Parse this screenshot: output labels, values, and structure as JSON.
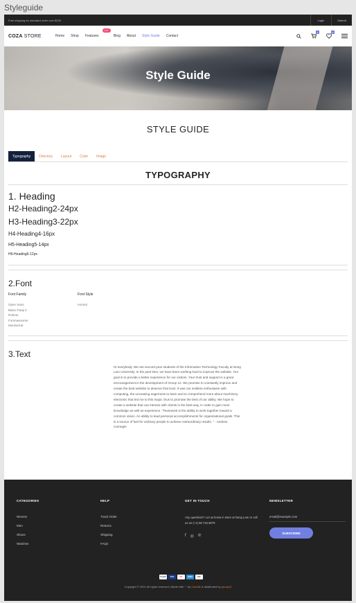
{
  "window_title": "Styleguide",
  "topbar": {
    "shipping": "Free shipping for standard order over $100",
    "login": "Login",
    "submit": "Submit"
  },
  "header": {
    "logo_bold": "COZA",
    "logo_thin": " STORE",
    "nav": [
      "Home",
      "Shop",
      "Features",
      "Blog",
      "About",
      "Style Guide",
      "Contact"
    ],
    "hot_badge": "HOT",
    "cart_count": "2",
    "wishlist_count": "0",
    "icons": [
      "search-icon",
      "cart-icon",
      "heart-icon",
      "menu-icon"
    ]
  },
  "hero": {
    "title": "Style Guide"
  },
  "main": {
    "title": "STYLE GUIDE",
    "tabs": [
      "Typography",
      "Directory",
      "Layout",
      "Color",
      "Image"
    ],
    "section_title": "TYPOGRAPHY"
  },
  "typography": {
    "h1": "1. Heading",
    "h2": "H2-Heading2-24px",
    "h3": "H3-Heading3-22px",
    "h4": "H4-Heading4-16px",
    "h5": "H5-Heading5-14px",
    "h6": "H6-Heading6-12px"
  },
  "font": {
    "title": "2.Font",
    "family_head": "Font Family",
    "style_head": "Font Style",
    "families": [
      "Open Sans",
      "Baloo Paaji 2",
      "Roboto",
      "FontAwesome",
      "Montserrat"
    ],
    "styles": [
      "normal"
    ]
  },
  "text": {
    "title": "3.Text",
    "paragraph": "Hi everybody. We are second-year students of the Information Technology Faculty at Nong Lam University. In the past time, we have been working hard to improve the website. Our goal is to provide a better experience for our visitors. Your trust and support is a great encouragement in the development of Group 12. We promise to constantly improve and create the best website to deserve that trust. It was our endless enthusiasm with computing, the unceasing eagerness to learn and to comprehend more about machinery electronic that led me to this major, thus to promote the best of our ability. We hope to create a website that can interact with clients in the best way, in order to gain more knowledge as well as experience. \"Teamwork is the ability to work together toward a common vision. An ability to lead personal accomplishments for organizational goals. This is a source of fuel for ordinary people to achieve extraordinary results. \" - Andrew Carnegie"
  },
  "footer": {
    "categories_title": "CATEGORIES",
    "categories": [
      "Women",
      "Men",
      "Shoes",
      "Watches"
    ],
    "help_title": "HELP",
    "help": [
      "Track Order",
      "Returns",
      "Shipping",
      "FAQs"
    ],
    "contact_title": "GET IN TOUCH",
    "contact_text": "Any questions? Let us know in store at Nong Lam or call us on (+1) 96 716 6879",
    "social_icons": [
      "facebook-icon",
      "instagram-icon",
      "pinterest-icon"
    ],
    "newsletter_title": "NEWSLETTER",
    "email_placeholder": "email@example.com",
    "subscribe": "SUBSCRIBE",
    "payments": [
      "PayPal",
      "VISA",
      "MC",
      "AMEX",
      "PAY"
    ],
    "copyright_prefix": "Copyright © 2021 All rights reserved | Made with ♡ by ",
    "copyright_brand1": "Colorlib",
    "copyright_mid": " & distributed by ",
    "copyright_brand2": "group12"
  },
  "colors": {
    "accent": "#717fe0",
    "hot": "#f74877",
    "tab_active": "#14213d",
    "tab_text": "#e07b3c",
    "footer_bg": "#222222"
  }
}
